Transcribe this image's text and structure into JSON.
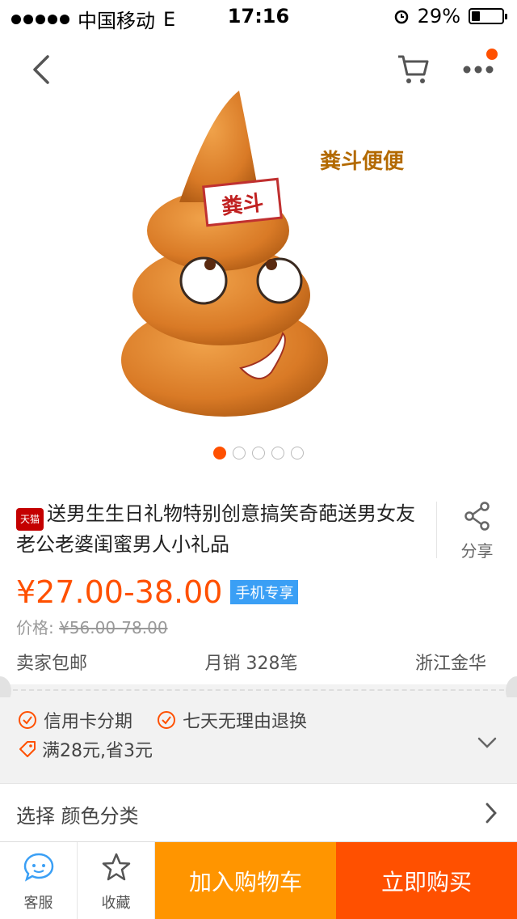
{
  "status_bar": {
    "carrier": "中国移动",
    "network": "E",
    "time": "17:16",
    "battery": "29%",
    "battery_level": 0.29
  },
  "nav": {
    "back_icon": "chevron-left-icon",
    "cart_icon": "cart-icon",
    "more_icon": "more-dots-icon",
    "has_notification": true
  },
  "gallery": {
    "image_overlay_text": "粪斗便便",
    "product_face_label": "粪斗",
    "page_count": 5,
    "active_page": 1
  },
  "product": {
    "store_badge": "天猫",
    "title": "送男生生日礼物特别创意搞笑奇葩送男女友老公老婆闺蜜男人小礼品",
    "share_label": "分享",
    "price": "¥27.00-38.00",
    "mobile_tag": "手机专享",
    "original_price_label": "价格:",
    "original_price": "¥56.00-78.00",
    "shipping": "卖家包邮",
    "monthly_sales": "月销 328笔",
    "location": "浙江金华"
  },
  "services": {
    "items": [
      "信用卡分期",
      "七天无理由退换"
    ],
    "promo": "满28元,省3元"
  },
  "selection": {
    "label": "选择 颜色分类"
  },
  "bottom_bar": {
    "service_label": "客服",
    "favorite_label": "收藏",
    "add_cart_label": "加入购物车",
    "buy_now_label": "立即购买"
  },
  "colors": {
    "accent": "#ff5000",
    "cart_button": "#ff9500",
    "mobile_tag": "#3a9ff5"
  }
}
